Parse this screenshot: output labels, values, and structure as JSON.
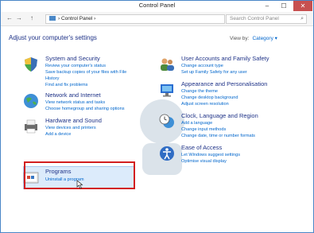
{
  "window": {
    "title": "Control Panel",
    "min": "–",
    "max": "☐",
    "close": "✕"
  },
  "address": {
    "back": "←",
    "forward": "→",
    "up": "↑",
    "path": "› Control Panel ›",
    "search_placeholder": "Search Control Panel",
    "search_icon": "⌕"
  },
  "heading": "Adjust your computer's settings",
  "view_by": {
    "label": "View by:",
    "value": "Category ▾"
  },
  "categories": [
    {
      "title": "System and Security",
      "links": [
        "Review your computer's status",
        "Save backup copies of your files with File",
        "History",
        "Find and fix problems"
      ],
      "icon": "shield-icon"
    },
    {
      "title": "Network and Internet",
      "links": [
        "View network status and tasks",
        "Choose homegroup and sharing options"
      ],
      "icon": "network-globe-icon"
    },
    {
      "title": "Hardware and Sound",
      "links": [
        "View devices and printers",
        "Add a device"
      ],
      "icon": "printer-icon"
    },
    {
      "title": "Programs",
      "links": [
        "Uninstall a program"
      ],
      "icon": "programs-icon"
    },
    {
      "title": "User Accounts and Family Safety",
      "links": [
        "Change account type",
        "Set up Family Safety for any user"
      ],
      "icon": "users-icon"
    },
    {
      "title": "Appearance and Personalisation",
      "links": [
        "Change the theme",
        "Change desktop background",
        "Adjust screen resolution"
      ],
      "icon": "monitor-icon"
    },
    {
      "title": "Clock, Language and Region",
      "links": [
        "Add a language",
        "Change input methods",
        "Change date, time or number formats"
      ],
      "icon": "clock-globe-icon"
    },
    {
      "title": "Ease of Access",
      "links": [
        "Let Windows suggest settings",
        "Optimise visual display"
      ],
      "icon": "ease-of-access-icon"
    }
  ],
  "colors": {
    "link": "#0066cc",
    "title": "#1e3287",
    "highlight_border": "#d21f1f"
  }
}
